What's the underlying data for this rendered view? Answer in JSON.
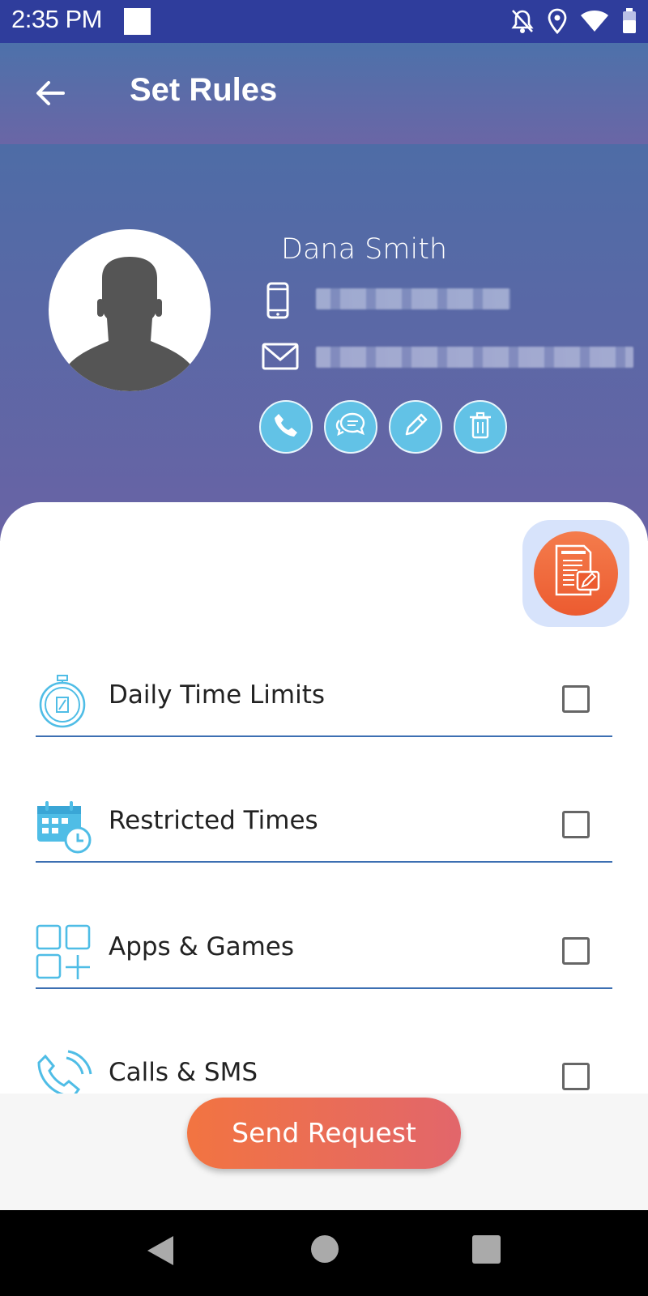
{
  "status_bar": {
    "time": "2:35 PM",
    "icons": [
      "notifications-off-icon",
      "location-icon",
      "wifi-icon",
      "battery-icon"
    ]
  },
  "header": {
    "title": "Set Rules",
    "back_icon": "arrow-left-icon"
  },
  "contact": {
    "name": "Dana Smith",
    "phone": "",
    "email": "",
    "actions": [
      "call-icon",
      "message-icon",
      "edit-icon",
      "delete-icon"
    ]
  },
  "rules": [
    {
      "label": "Daily Time Limits",
      "icon": "stopwatch-icon",
      "checked": false
    },
    {
      "label": "Restricted Times",
      "icon": "calendar-clock-icon",
      "checked": false
    },
    {
      "label": "Apps & Games",
      "icon": "apps-grid-icon",
      "checked": false
    },
    {
      "label": "Calls & SMS",
      "icon": "phone-call-icon",
      "checked": false
    }
  ],
  "send_button": {
    "label": "Send Request"
  },
  "colors": {
    "status_bar": "#2f3d9c",
    "header_gradient_top": "#4d71aa",
    "header_gradient_bottom": "#6a66a6",
    "accent_blue": "#62c2e6",
    "accent_orange": "#f27441",
    "divider": "#3c6fb2"
  }
}
